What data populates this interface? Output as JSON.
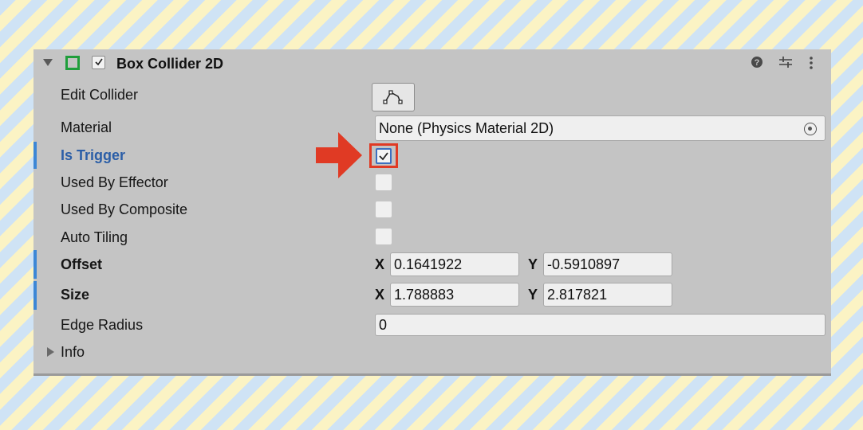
{
  "component": {
    "title": "Box Collider 2D",
    "enabled": true,
    "icon": "box-collider-icon",
    "header_icons": [
      "help-icon",
      "presets-icon",
      "more-menu-icon"
    ]
  },
  "fields": {
    "edit_collider": {
      "label": "Edit Collider",
      "icon": "edit-collider-icon"
    },
    "material": {
      "label": "Material",
      "value": "None (Physics Material 2D)"
    },
    "is_trigger": {
      "label": "Is Trigger",
      "checked": true
    },
    "used_by_effector": {
      "label": "Used By Effector",
      "checked": false
    },
    "used_by_composite": {
      "label": "Used By Composite",
      "checked": false
    },
    "auto_tiling": {
      "label": "Auto Tiling",
      "checked": false
    },
    "offset": {
      "label": "Offset",
      "x_label": "X",
      "x": "0.1641922",
      "y_label": "Y",
      "y": "-0.5910897"
    },
    "size": {
      "label": "Size",
      "x_label": "X",
      "x": "1.788883",
      "y_label": "Y",
      "y": "2.817821"
    },
    "edge_radius": {
      "label": "Edge Radius",
      "value": "0"
    },
    "info": {
      "label": "Info"
    }
  },
  "colors": {
    "highlight_label": "#2b5ea7",
    "accent_bar": "#3c87d6",
    "annotation_red": "#e03a24"
  }
}
